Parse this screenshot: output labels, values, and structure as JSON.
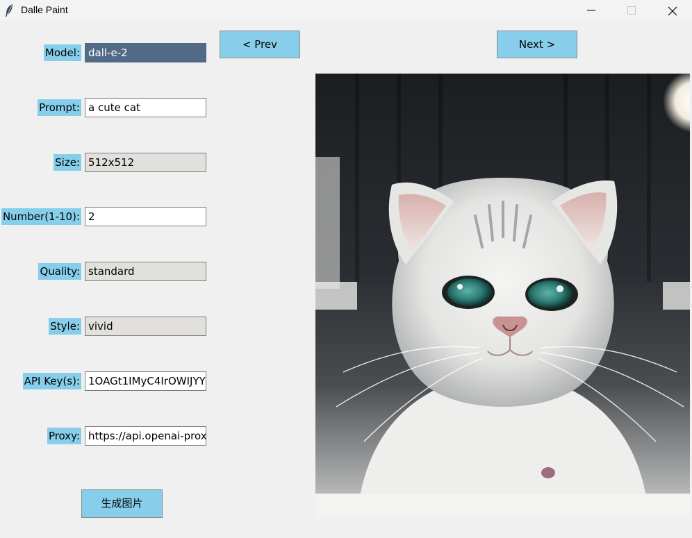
{
  "window": {
    "title": "Dalle Paint",
    "icon": "feather-icon",
    "controls": [
      "minimize-icon",
      "maximize-icon",
      "close-icon"
    ]
  },
  "form": {
    "model": {
      "label": "Model:",
      "value": "dall-e-2"
    },
    "prompt": {
      "label": "Prompt:",
      "value": "a cute cat"
    },
    "size": {
      "label": "Size:",
      "value": "512x512"
    },
    "number": {
      "label": "Number(1-10):",
      "value": "2"
    },
    "quality": {
      "label": "Quality:",
      "value": "standard"
    },
    "style": {
      "label": "Style:",
      "value": "vivid"
    },
    "api_key": {
      "label": "API Key(s):",
      "value": "1OAGt1IMyC4IrOWIJYY"
    },
    "proxy": {
      "label": "Proxy:",
      "value": "https://api.openai-proxy"
    },
    "generate_label": "生成图片"
  },
  "nav": {
    "prev_label": "< Prev",
    "next_label": "Next >"
  },
  "image": {
    "subject": "white-grey kitten photo"
  },
  "colors": {
    "label_bg": "#87ceeb",
    "button_bg": "#87ceeb",
    "selected_bg": "#516b87"
  }
}
